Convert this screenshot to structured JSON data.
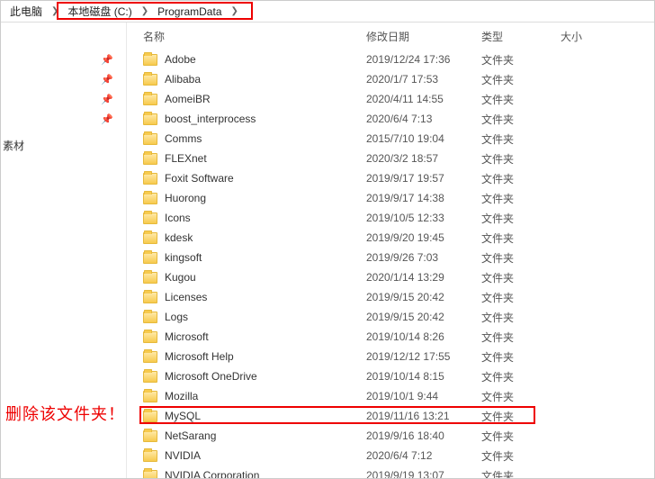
{
  "breadcrumb": {
    "root": "此电脑",
    "segs": [
      "本地磁盘 (C:)",
      "ProgramData"
    ]
  },
  "headers": {
    "name": "名称",
    "date": "修改日期",
    "type": "类型",
    "size": "大小"
  },
  "type_folder": "文件夹",
  "annotation": "删除该文件夹！",
  "sidebar": {
    "label": "素材"
  },
  "rows": [
    {
      "name": "Adobe",
      "date": "2019/12/24 17:36"
    },
    {
      "name": "Alibaba",
      "date": "2020/1/7 17:53"
    },
    {
      "name": "AomeiBR",
      "date": "2020/4/11 14:55"
    },
    {
      "name": "boost_interprocess",
      "date": "2020/6/4 7:13"
    },
    {
      "name": "Comms",
      "date": "2015/7/10 19:04"
    },
    {
      "name": "FLEXnet",
      "date": "2020/3/2 18:57"
    },
    {
      "name": "Foxit Software",
      "date": "2019/9/17 19:57"
    },
    {
      "name": "Huorong",
      "date": "2019/9/17 14:38"
    },
    {
      "name": "Icons",
      "date": "2019/10/5 12:33"
    },
    {
      "name": "kdesk",
      "date": "2019/9/20 19:45"
    },
    {
      "name": "kingsoft",
      "date": "2019/9/26 7:03"
    },
    {
      "name": "Kugou",
      "date": "2020/1/14 13:29"
    },
    {
      "name": "Licenses",
      "date": "2019/9/15 20:42"
    },
    {
      "name": "Logs",
      "date": "2019/9/15 20:42"
    },
    {
      "name": "Microsoft",
      "date": "2019/10/14 8:26"
    },
    {
      "name": "Microsoft Help",
      "date": "2019/12/12 17:55"
    },
    {
      "name": "Microsoft OneDrive",
      "date": "2019/10/14 8:15"
    },
    {
      "name": "Mozilla",
      "date": "2019/10/1 9:44"
    },
    {
      "name": "MySQL",
      "date": "2019/11/16 13:21",
      "highlight": true
    },
    {
      "name": "NetSarang",
      "date": "2019/9/16 18:40"
    },
    {
      "name": "NVIDIA",
      "date": "2020/6/4 7:12"
    },
    {
      "name": "NVIDIA Corporation",
      "date": "2019/9/19 13:07"
    }
  ]
}
